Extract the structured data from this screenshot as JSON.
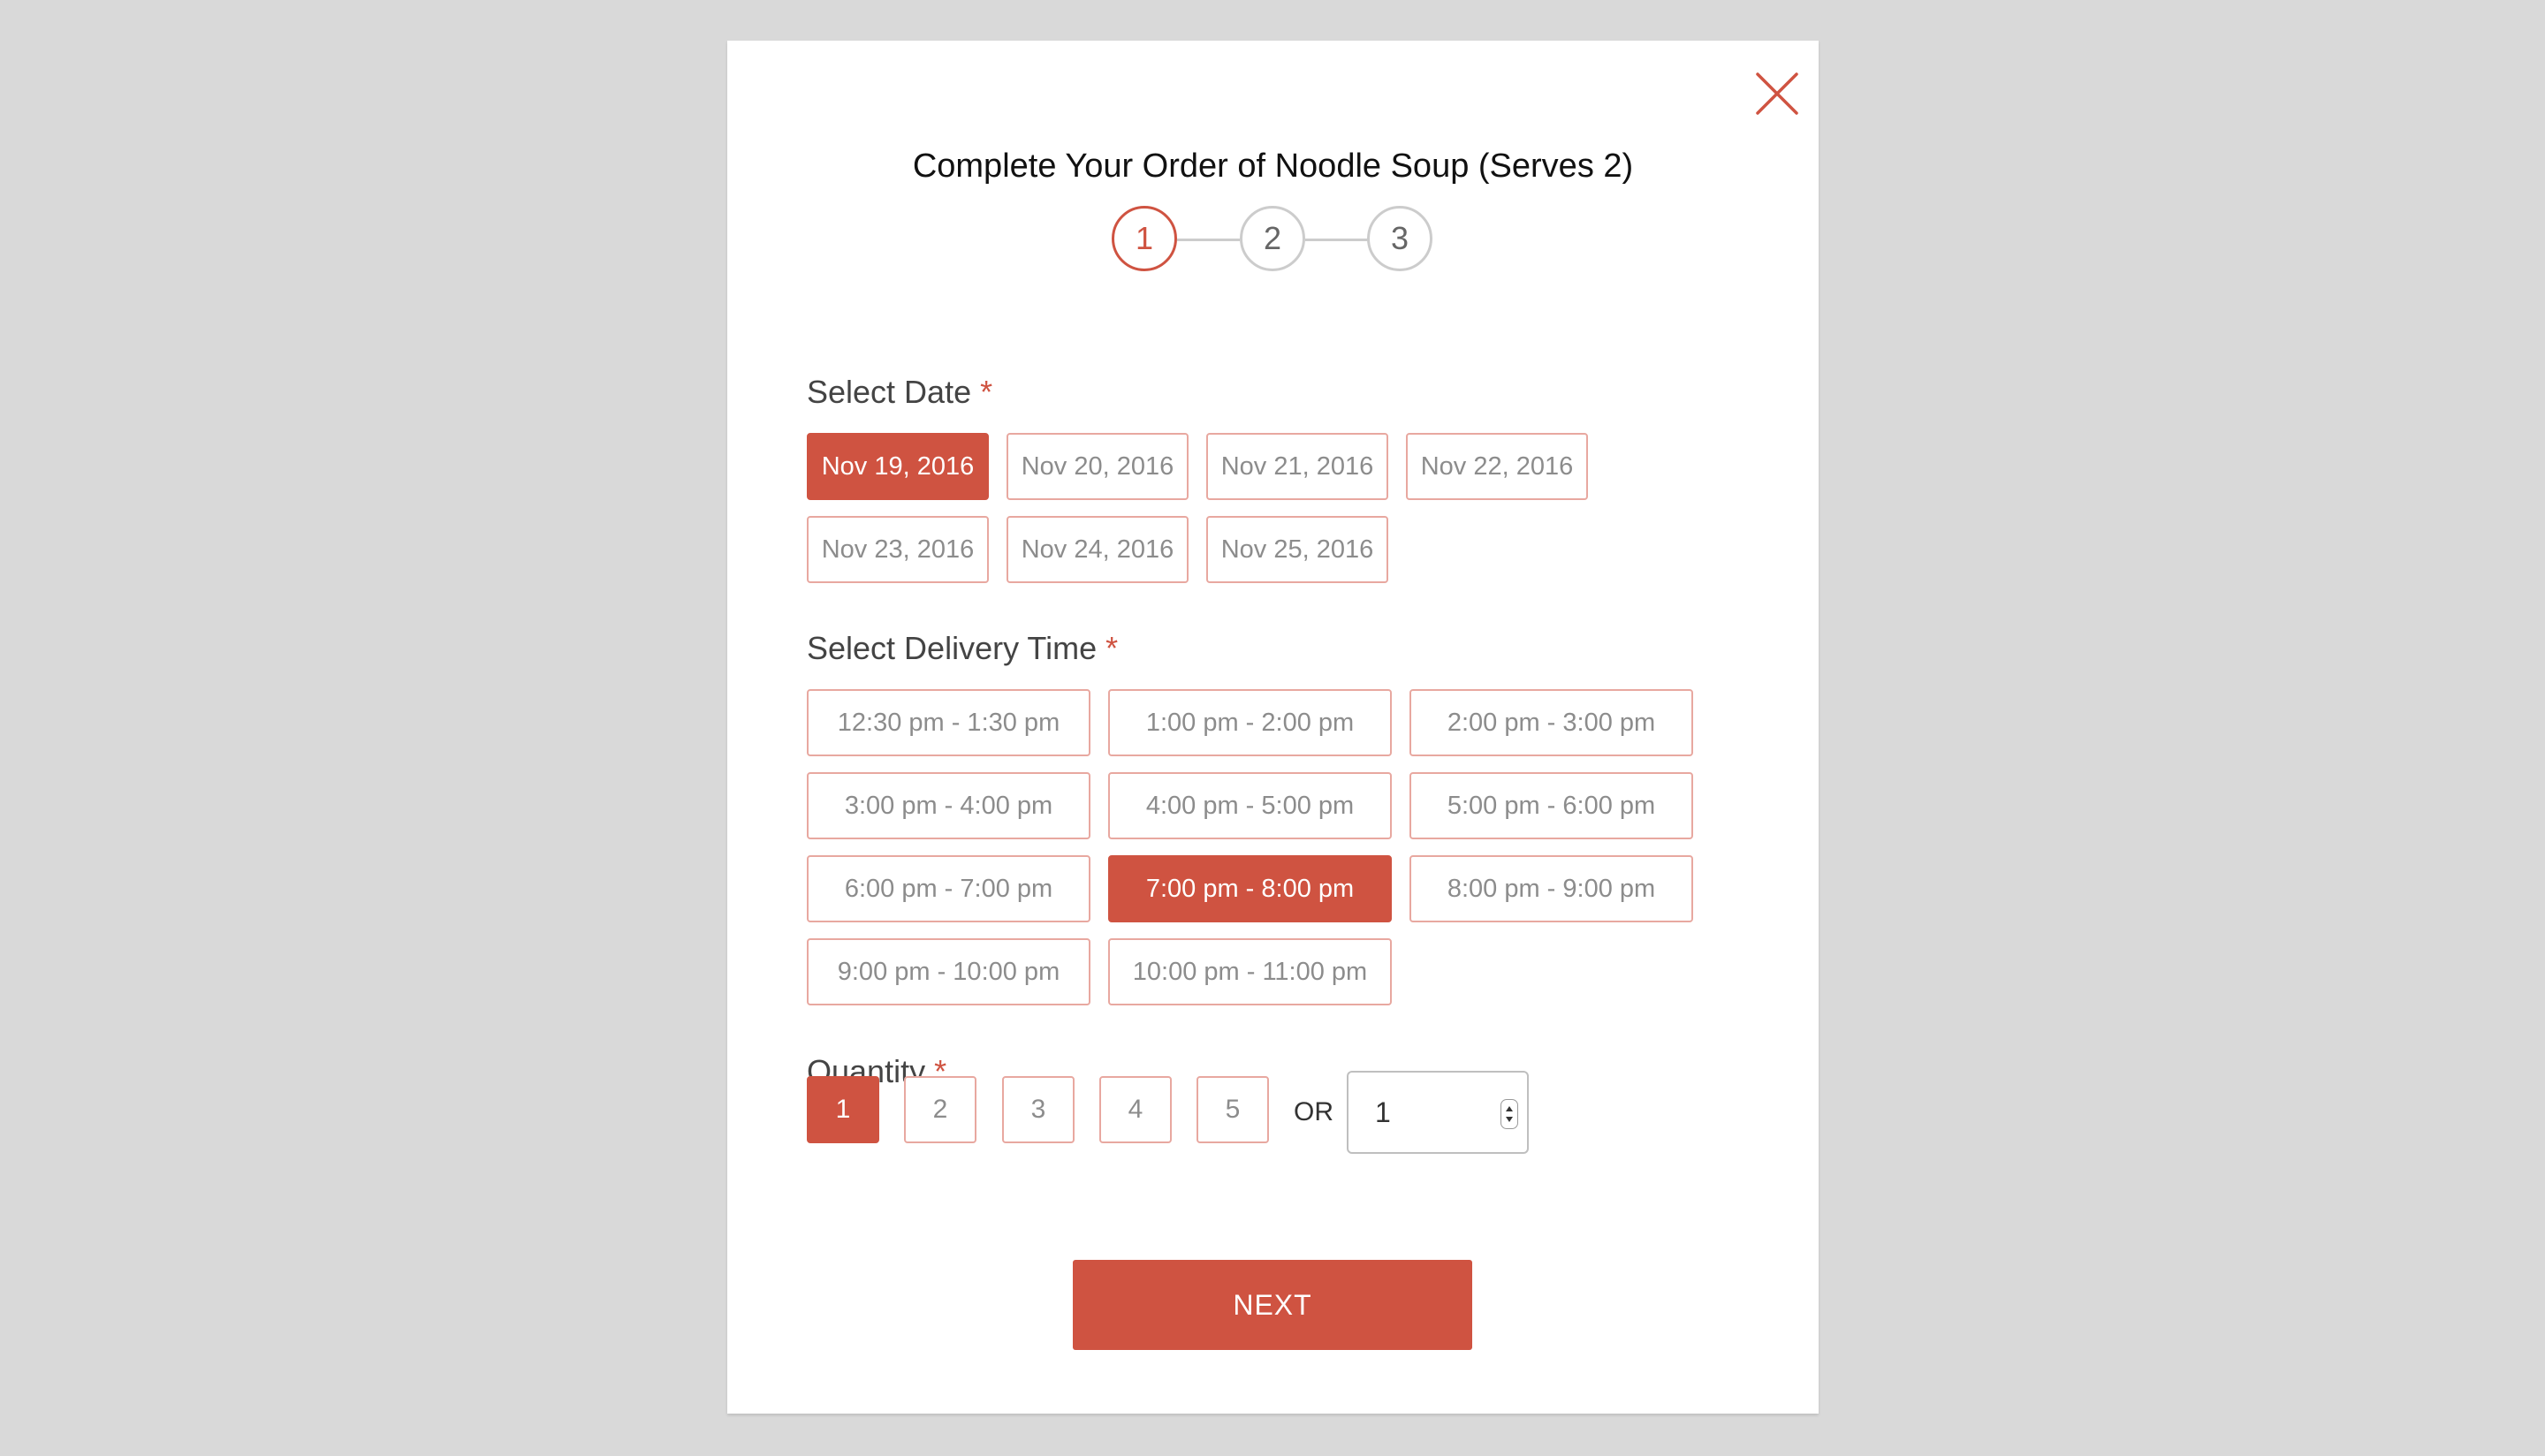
{
  "modal": {
    "title": "Complete Your Order of Noodle Soup (Serves 2)",
    "close_icon": "close-icon",
    "accent_color": "#cf5341"
  },
  "steps": {
    "items": [
      "1",
      "2",
      "3"
    ],
    "active": "1"
  },
  "date_section": {
    "label": "Select Date",
    "required_mark": "*",
    "options": [
      "Nov 19, 2016",
      "Nov 20, 2016",
      "Nov 21, 2016",
      "Nov 22, 2016",
      "Nov 23, 2016",
      "Nov 24, 2016",
      "Nov 25, 2016"
    ],
    "selected": "Nov 19, 2016"
  },
  "time_section": {
    "label": "Select Delivery Time",
    "required_mark": "*",
    "options": [
      "12:30 pm - 1:30 pm",
      "1:00 pm - 2:00 pm",
      "2:00 pm - 3:00 pm",
      "3:00 pm - 4:00 pm",
      "4:00 pm - 5:00 pm",
      "5:00 pm - 6:00 pm",
      "6:00 pm - 7:00 pm",
      "7:00 pm - 8:00 pm",
      "8:00 pm - 9:00 pm",
      "9:00 pm - 10:00 pm",
      "10:00 pm - 11:00 pm"
    ],
    "selected": "7:00 pm - 8:00 pm"
  },
  "quantity_section": {
    "label": "Quantity",
    "required_mark": "*",
    "options": [
      "1",
      "2",
      "3",
      "4",
      "5"
    ],
    "selected": "1",
    "or_label": "OR",
    "input_value": "1"
  },
  "next_button": {
    "label": "NEXT"
  }
}
